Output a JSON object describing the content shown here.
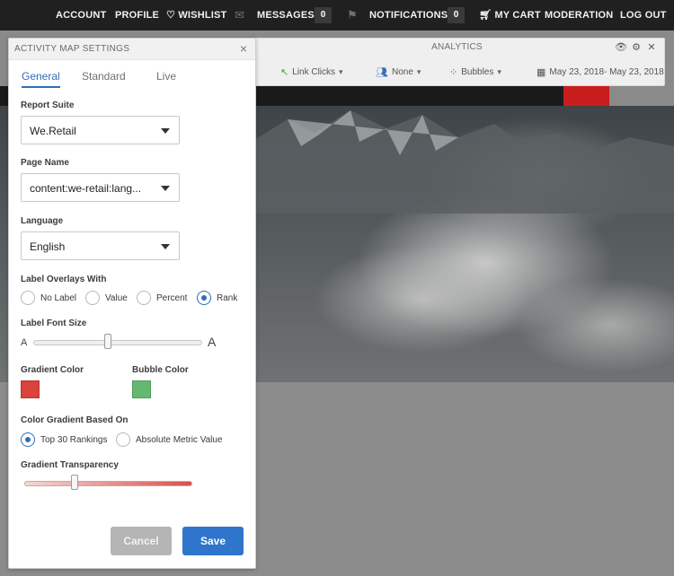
{
  "topnav": {
    "account": "ACCOUNT",
    "profile": "PROFILE",
    "wishlist": "WISHLIST",
    "messages": "MESSAGES",
    "messages_count": "0",
    "notifications": "NOTIFICATIONS",
    "notifications_count": "0",
    "cart": "MY CART",
    "moderation": "MODERATION",
    "logout": "LOG OUT"
  },
  "analytics": {
    "title": "ANALYTICS",
    "link_clicks": "Link Clicks",
    "none": "None",
    "bubbles": "Bubbles",
    "date_range": "May 23, 2018- May 23, 2018"
  },
  "modal": {
    "title": "ACTIVITY MAP SETTINGS",
    "close_glyph": "×",
    "tabs": [
      "General",
      "Standard",
      "Live"
    ],
    "report_suite_label": "Report Suite",
    "report_suite_value": "We.Retail",
    "page_name_label": "Page Name",
    "page_name_value": "content:we-retail:lang...",
    "language_label": "Language",
    "language_value": "English",
    "label_overlays_label": "Label Overlays With",
    "overlay_options": [
      "No Label",
      "Value",
      "Percent",
      "Rank"
    ],
    "overlay_selected": "Rank",
    "label_font_size_label": "Label Font Size",
    "font_size_small": "A",
    "font_size_large": "A",
    "font_size_level": 0.44,
    "gradient_color_label": "Gradient Color",
    "gradient_color": "#d9433b",
    "bubble_color_label": "Bubble Color",
    "bubble_color": "#63b96f",
    "color_gradient_label": "Color Gradient Based On",
    "gradient_options": [
      "Top 30 Rankings",
      "Absolute Metric Value"
    ],
    "gradient_selected": "Top 30 Rankings",
    "gradient_transparency_label": "Gradient Transparency",
    "gradient_transparency_level": 0.3,
    "cancel_label": "Cancel",
    "save_label": "Save"
  }
}
